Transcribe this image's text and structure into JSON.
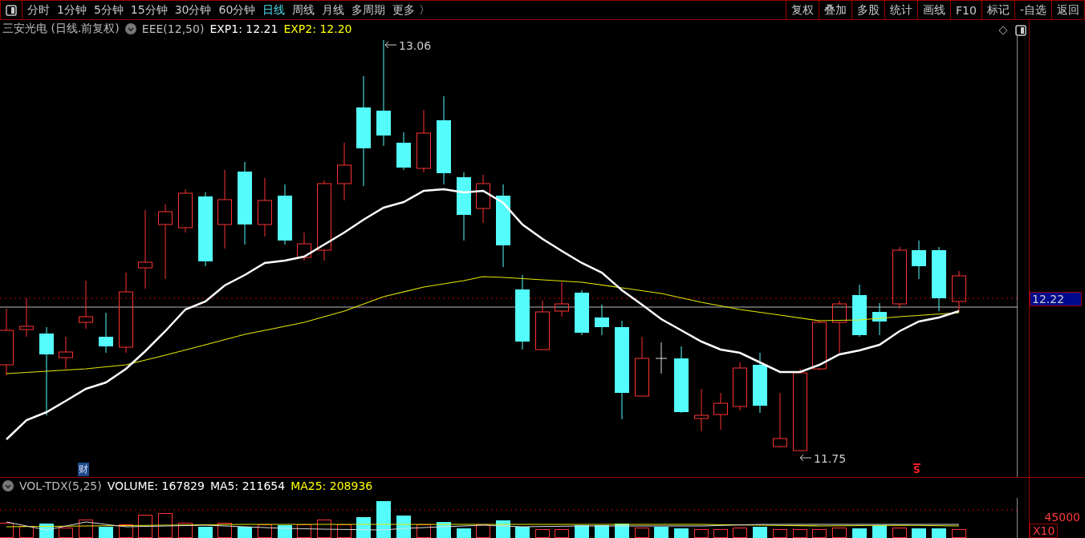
{
  "toolbar": {
    "tabs": [
      {
        "label": "分时",
        "selected": false
      },
      {
        "label": "1分钟",
        "selected": false
      },
      {
        "label": "5分钟",
        "selected": false
      },
      {
        "label": "15分钟",
        "selected": false
      },
      {
        "label": "30分钟",
        "selected": false
      },
      {
        "label": "60分钟",
        "selected": false
      },
      {
        "label": "日线",
        "selected": true
      },
      {
        "label": "周线",
        "selected": false
      },
      {
        "label": "月线",
        "selected": false
      },
      {
        "label": "多周期",
        "selected": false
      },
      {
        "label": "更多 〉",
        "selected": false
      }
    ],
    "buttons": [
      "复权",
      "叠加",
      "多股",
      "统计",
      "画线",
      "F10",
      "标记",
      "-自选",
      "返回"
    ]
  },
  "chart": {
    "title": "三安光电 (日线.前复权)",
    "indicator": "EEE(12,50)",
    "legend": [
      {
        "label": "EXP1: 12.21",
        "color": "#ffffff"
      },
      {
        "label": "EXP2: 12.20",
        "color": "#ffff00"
      }
    ],
    "high_label": "13.06",
    "low_label": "11.75",
    "price_tag": "12.22",
    "event_marker": "财",
    "signal_marker": "S"
  },
  "volume": {
    "indicator": "VOL-TDX(5,25)",
    "legend": [
      {
        "label": "VOLUME: 167829",
        "color": "#ffffff"
      },
      {
        "label": "MA5: 211654",
        "color": "#ffffff"
      },
      {
        "label": "MA25: 208936",
        "color": "#ffff00"
      }
    ],
    "scale_label": "45000",
    "multiplier": "X10"
  }
}
